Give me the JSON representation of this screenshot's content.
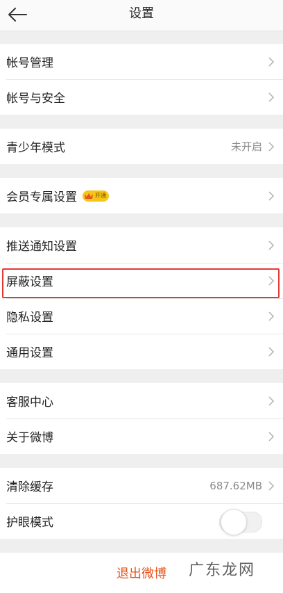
{
  "header": {
    "title": "设置"
  },
  "groups": [
    {
      "items": [
        {
          "label": "帐号管理"
        },
        {
          "label": "帐号与安全"
        }
      ]
    },
    {
      "items": [
        {
          "label": "青少年模式",
          "value": "未开启"
        }
      ]
    },
    {
      "items": [
        {
          "label": "会员专属设置",
          "badge": "开通"
        }
      ]
    },
    {
      "items": [
        {
          "label": "推送通知设置"
        },
        {
          "label": "屏蔽设置"
        },
        {
          "label": "隐私设置"
        },
        {
          "label": "通用设置"
        }
      ]
    },
    {
      "items": [
        {
          "label": "客服中心"
        },
        {
          "label": "关于微博"
        }
      ]
    },
    {
      "items": [
        {
          "label": "清除缓存",
          "value": "687.62MB"
        },
        {
          "label": "护眼模式",
          "toggle": false
        }
      ]
    }
  ],
  "logout": {
    "label": "退出微博"
  },
  "watermark": "广东龙网",
  "colors": {
    "accent": "#e8541e",
    "highlight": "#e53935"
  }
}
